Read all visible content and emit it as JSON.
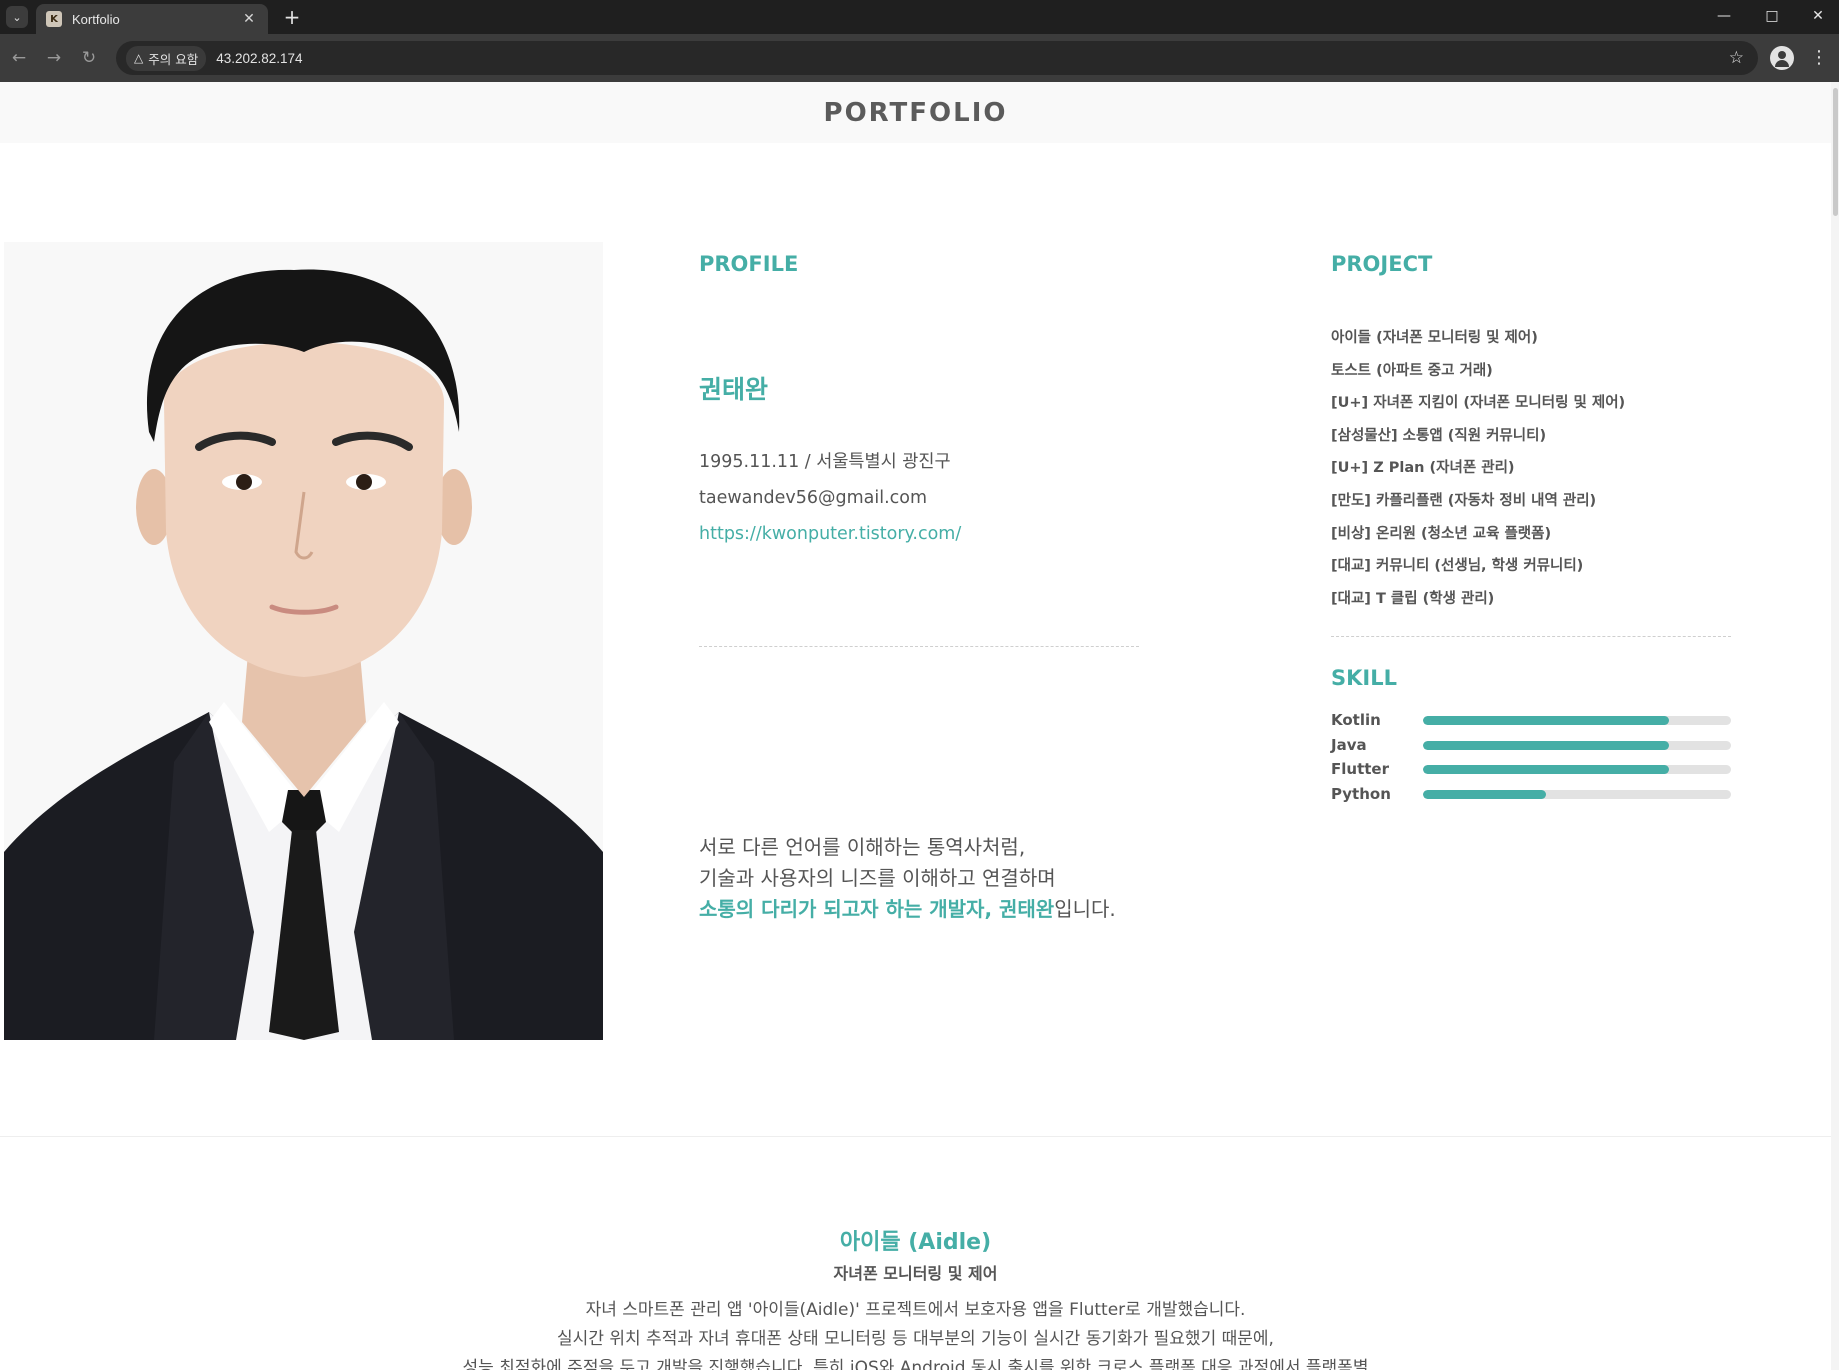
{
  "browser": {
    "tab_title": "Kortfolio",
    "favicon_text": "K",
    "new_tab": "+",
    "security_label": "주의 요함",
    "url": "43.202.82.174"
  },
  "header": {
    "title": "PORTFOLIO"
  },
  "profile": {
    "section_title": "PROFILE",
    "name": "권태완",
    "birth_location": "1995.11.11 / 서울특별시 광진구",
    "email": "taewandev56@gmail.com",
    "blog": "https://kwonputer.tistory.com/",
    "intro_line1": "서로 다른 언어를 이해하는 통역사처럼,",
    "intro_line2": "기술과 사용자의 니즈를 이해하고 연결하며",
    "intro_highlight": "소통의 다리가 되고자 하는 개발자, 권태완",
    "intro_suffix": "입니다."
  },
  "projects": {
    "section_title": "PROJECT",
    "items": [
      "아이들 (자녀폰 모니터링 및 제어)",
      "토스트 (아파트 중고 거래)",
      "[U+] 자녀폰 지킴이 (자녀폰 모니터링 및 제어)",
      "[삼성물산] 소통앱 (직원 커뮤니티)",
      "[U+] Z Plan (자녀폰 관리)",
      "[만도] 카플리플랜 (자동차 정비 내역 관리)",
      "[비상] 온리원 (청소년 교육 플랫폼)",
      "[대교] 커뮤니티 (선생님, 학생 커뮤니티)",
      "[대교] T 클립 (학생 관리)"
    ]
  },
  "skills": {
    "section_title": "SKILL",
    "items": [
      {
        "name": "Kotlin",
        "level": 0.8
      },
      {
        "name": "Java",
        "level": 0.8
      },
      {
        "name": "Flutter",
        "level": 0.8
      },
      {
        "name": "Python",
        "level": 0.4
      }
    ]
  },
  "project_detail": {
    "title": "아이들 (Aidle)",
    "subtitle": "자녀폰 모니터링 및 제어",
    "line1": "자녀 스마트폰 관리 앱 '아이들(Aidle)' 프로젝트에서 보호자용 앱을 Flutter로 개발했습니다.",
    "line2": "실시간 위치 추적과 자녀 휴대폰 상태 모니터링 등 대부분의 기능이 실시간 동기화가 필요했기 때문에,",
    "line3": "성능 최적화에 주점을 두고 개발을 진행했습니다. 특히 iOS와 Android 동시 출시를 위한 크로스 플랫폼 대응 과정에서 플랫폼별"
  },
  "colors": {
    "accent": "#45aea6",
    "text": "#555555",
    "chrome_dark": "#1f1f1f",
    "chrome_mid": "#3c3c3c"
  }
}
